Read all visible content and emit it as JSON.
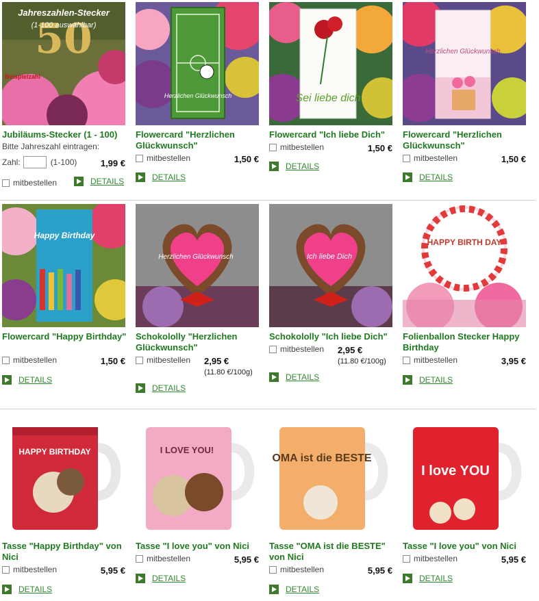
{
  "shared": {
    "checkbox_label": "mitbestellen",
    "details_label": "DETAILS"
  },
  "row1": {
    "c1": {
      "image_text": "Jahreszahlen-Stecker",
      "image_text2": "(1-100 auswählbar)",
      "image_badge": "Beispielzahl",
      "image_number": "50",
      "title": "Jubiläums-Stecker (1 - 100)",
      "hint": "Bitte Jahreszahl eintragen:",
      "qty_label": "Zahl:",
      "qty_range": "(1-100)",
      "price": "1,99 €"
    },
    "c2": {
      "image_text": "Herzlichen Glückwunsch",
      "title": "Flowercard \"Herzlichen Glückwunsch\"",
      "price": "1,50 €"
    },
    "c3": {
      "image_text": "Sei liebe dich",
      "title": "Flowercard \"Ich liebe Dich\"",
      "price": "1,50 €"
    },
    "c4": {
      "image_text": "Herzlichen Glückwunsch",
      "title": "Flowercard \"Herzlichen Glückwunsch\"",
      "price": "1,50 €"
    }
  },
  "row2": {
    "c1": {
      "image_text": "Happy Birthday",
      "title": "Flowercard \"Happy Birthday\"",
      "price": "1,50 €"
    },
    "c2": {
      "image_text": "Herzlichen Glückwunsch",
      "title": "Schokololly \"Herzlichen Glückwunsch\"",
      "price": "2,95 €",
      "unit": "(11.80 €/100g)"
    },
    "c3": {
      "image_text": "Ich liebe Dich",
      "title": "Schokololly \"Ich liebe Dich\"",
      "price": "2,95 €",
      "unit": "(11.80 €/100g)"
    },
    "c4": {
      "image_text": "HAPPY BIRTH DAY",
      "title": "Folienballon Stecker Happy Birthday",
      "price": "3,95 €"
    }
  },
  "row3": {
    "c1": {
      "image_text": "HAPPY BIRTHDAY",
      "title": "Tasse \"Happy Birthday\" von Nici",
      "price": "5,95 €"
    },
    "c2": {
      "image_text": "I LOVE YOU!",
      "title": "Tasse \"I love you\" von Nici",
      "price": "5,95 €"
    },
    "c3": {
      "image_text": "OMA ist die BESTE",
      "title": "Tasse \"OMA ist die BESTE\" von Nici",
      "price": "5,95 €"
    },
    "c4": {
      "image_text": "I love YOU",
      "title": "Tasse \"I love you\" von Nici",
      "price": "5,95 €"
    }
  },
  "colors": {
    "title_green": "#1f7a1f",
    "link_green": "#2f8a2f",
    "icon_green": "#3d7a2c"
  }
}
